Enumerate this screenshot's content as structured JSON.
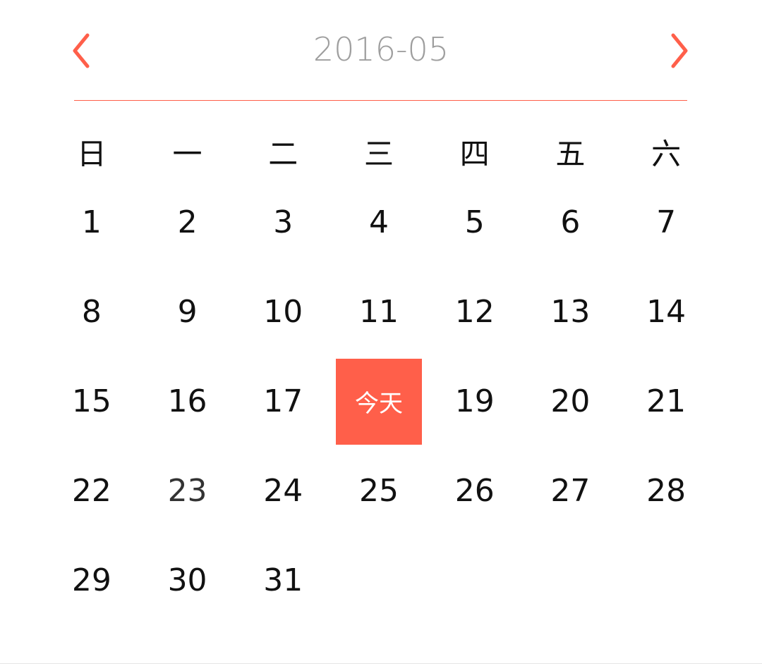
{
  "header": {
    "title": "2016-05",
    "prev_icon": "chevron-left-icon",
    "next_icon": "chevron-right-icon"
  },
  "colors": {
    "accent": "#ff5f4a",
    "title": "#9e9e9e",
    "text": "#111111"
  },
  "weekdays": [
    "日",
    "一",
    "二",
    "三",
    "四",
    "五",
    "六"
  ],
  "today_label": "今天",
  "days": [
    [
      "1",
      "2",
      "3",
      "4",
      "5",
      "6",
      "7"
    ],
    [
      "8",
      "9",
      "10",
      "11",
      "12",
      "13",
      "14"
    ],
    [
      "15",
      "16",
      "17",
      "今天",
      "19",
      "20",
      "21"
    ],
    [
      "22",
      "23",
      "24",
      "25",
      "26",
      "27",
      "28"
    ],
    [
      "29",
      "30",
      "31",
      "",
      "",
      "",
      ""
    ]
  ],
  "today_position": {
    "row": 2,
    "col": 3
  },
  "muted_position": {
    "row": 3,
    "col": 1
  }
}
